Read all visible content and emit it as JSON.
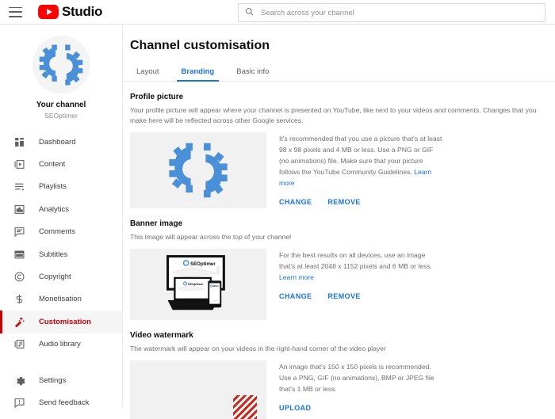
{
  "topbar": {
    "menu_icon": "hamburger-icon",
    "logo_icon": "youtube-play-icon",
    "brand": "Studio",
    "search_icon": "search-icon",
    "search_placeholder": "Search across your channel",
    "search_value": ""
  },
  "sidebar": {
    "avatar_icon": "seoptimer-gear-logo",
    "channel_title": "Your channel",
    "channel_name": "SEOptimer",
    "items": [
      {
        "label": "Dashboard",
        "icon": "dashboard-icon",
        "active": false
      },
      {
        "label": "Content",
        "icon": "content-icon",
        "active": false
      },
      {
        "label": "Playlists",
        "icon": "playlists-icon",
        "active": false
      },
      {
        "label": "Analytics",
        "icon": "analytics-icon",
        "active": false
      },
      {
        "label": "Comments",
        "icon": "comments-icon",
        "active": false
      },
      {
        "label": "Subtitles",
        "icon": "subtitles-icon",
        "active": false
      },
      {
        "label": "Copyright",
        "icon": "copyright-icon",
        "active": false
      },
      {
        "label": "Monetisation",
        "icon": "dollar-icon",
        "active": false
      },
      {
        "label": "Customisation",
        "icon": "magic-wand-icon",
        "active": true
      },
      {
        "label": "Audio library",
        "icon": "audio-library-icon",
        "active": false
      }
    ],
    "footer_items": [
      {
        "label": "Settings",
        "icon": "gear-icon"
      },
      {
        "label": "Send feedback",
        "icon": "feedback-icon"
      }
    ]
  },
  "main": {
    "page_title": "Channel customisation",
    "tabs": [
      {
        "label": "Layout",
        "active": false
      },
      {
        "label": "Branding",
        "active": true
      },
      {
        "label": "Basic info",
        "active": false
      }
    ],
    "sections": [
      {
        "title": "Profile picture",
        "description": "Your profile picture will appear where your channel is presented on YouTube, like next to your videos and comments. Changes that you make here will be reflected across other Google services.",
        "hint": "It's recommended that you use a picture that's at least 98 x 98 pixels and 4 MB or less. Use a PNG or GIF (no animations) file. Make sure that your picture follows the YouTube Community Guidelines.",
        "hint_link": "Learn more",
        "thumb_icon": "seoptimer-gear-logo",
        "actions": [
          "CHANGE",
          "REMOVE"
        ]
      },
      {
        "title": "Banner image",
        "description": "This image will appear across the top of your channel",
        "hint": "For the best results on all devices, use an image that's at least 2048 x 1152 pixels and 6 MB or less.",
        "hint_link": "Learn more",
        "thumb_icon": "device-preview-illustration",
        "actions": [
          "CHANGE",
          "REMOVE"
        ]
      },
      {
        "title": "Video watermark",
        "description": "The watermark will appear on your videos in the right-hand corner of the video player",
        "hint": "An image that's 150 x 150 pixels is recommended. Use a PNG, GIF (no animations), BMP or JPEG file that's 1 MB or less.",
        "hint_link": "",
        "thumb_icon": "red-diagonal-hatch",
        "actions": [
          "UPLOAD"
        ]
      }
    ]
  },
  "colors": {
    "youtube_red": "#ff0000",
    "active_red": "#cc0000",
    "link_blue": "#1a73e8",
    "logo_blue": "#4a90d9",
    "hatch_red": "#c92b20",
    "thumb_bg": "#f1f1f1"
  }
}
